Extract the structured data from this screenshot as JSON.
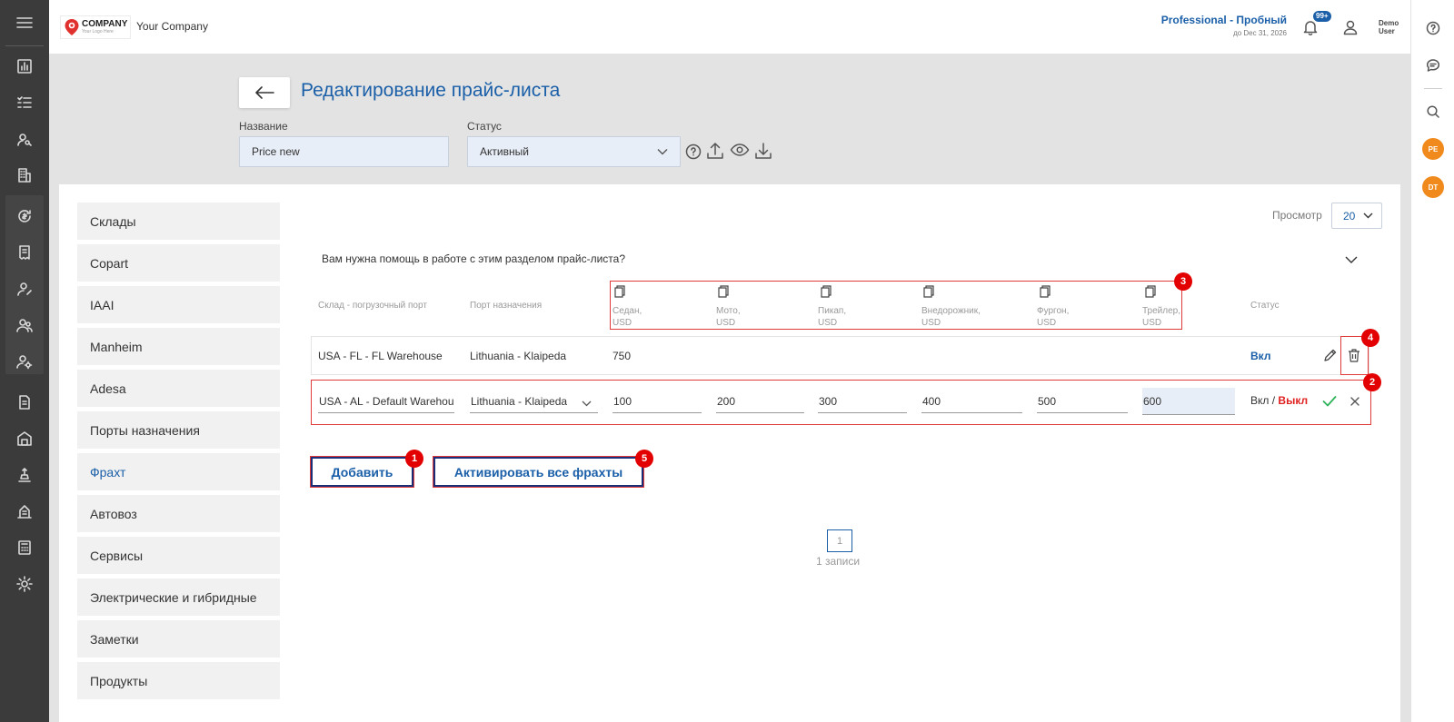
{
  "topbar": {
    "logo_line1": "COMPANY",
    "logo_line2": "Your Logo Here",
    "company_name": "Your Company",
    "plan_title": "Professional - Пробный",
    "plan_subtitle": "до Dec 31, 2026",
    "notification_count": "99+",
    "user_name": "Demo User"
  },
  "header": {
    "title": "Редактирование прайс-листа",
    "name_label": "Название",
    "name_value": "Price new",
    "status_label": "Статус",
    "status_value": "Активный"
  },
  "sections": [
    {
      "label": "Склады"
    },
    {
      "label": "Copart"
    },
    {
      "label": "IAAI"
    },
    {
      "label": "Manheim"
    },
    {
      "label": "Adesa"
    },
    {
      "label": "Порты назначения"
    },
    {
      "label": "Фрахт"
    },
    {
      "label": "Автовоз"
    },
    {
      "label": "Сервисы"
    },
    {
      "label": "Электрические и гибридные"
    },
    {
      "label": "Заметки"
    },
    {
      "label": "Продукты"
    }
  ],
  "active_section": "Фрахт",
  "view": {
    "label": "Просмотр",
    "value": "20"
  },
  "help_question": "Вам нужна помощь в работе с этим разделом прайс-листа?",
  "table": {
    "col_warehouse": "Склад - погрузочный порт",
    "col_destination": "Порт назначения",
    "price_cols": [
      {
        "line1": "Седан,",
        "line2": "USD"
      },
      {
        "line1": "Мото,",
        "line2": "USD"
      },
      {
        "line1": "Пикап,",
        "line2": "USD"
      },
      {
        "line1": "Внедорожник,",
        "line2": "USD"
      },
      {
        "line1": "Фургон,",
        "line2": "USD"
      },
      {
        "line1": "Трейлер,",
        "line2": "USD"
      }
    ],
    "col_status": "Статус",
    "row1": {
      "warehouse": "USA - FL - FL Warehouse",
      "destination": "Lithuania - Klaipeda",
      "sedan": "750",
      "status": "Вкл"
    },
    "row2": {
      "warehouse": "USA - AL - Default Warehouse",
      "destination": "Lithuania - Klaipeda",
      "prices": [
        "100",
        "200",
        "300",
        "400",
        "500",
        "600"
      ],
      "status_on": "Вкл",
      "status_sep": " / ",
      "status_off": "Выкл"
    }
  },
  "buttons": {
    "add": "Добавить",
    "activate_all": "Активировать все фрахты"
  },
  "pagination": {
    "page": "1",
    "records": "1 записи"
  },
  "markers": [
    "1",
    "2",
    "3",
    "4",
    "5"
  ],
  "colors": {
    "accent": "#1a5fa8",
    "sidebar": "#3b3b3b",
    "marker": "#e30000",
    "avatar": "#f08a1c",
    "confirm": "#2db35a"
  },
  "right_bar": {
    "avatar1": "PE",
    "avatar2": "DT"
  }
}
